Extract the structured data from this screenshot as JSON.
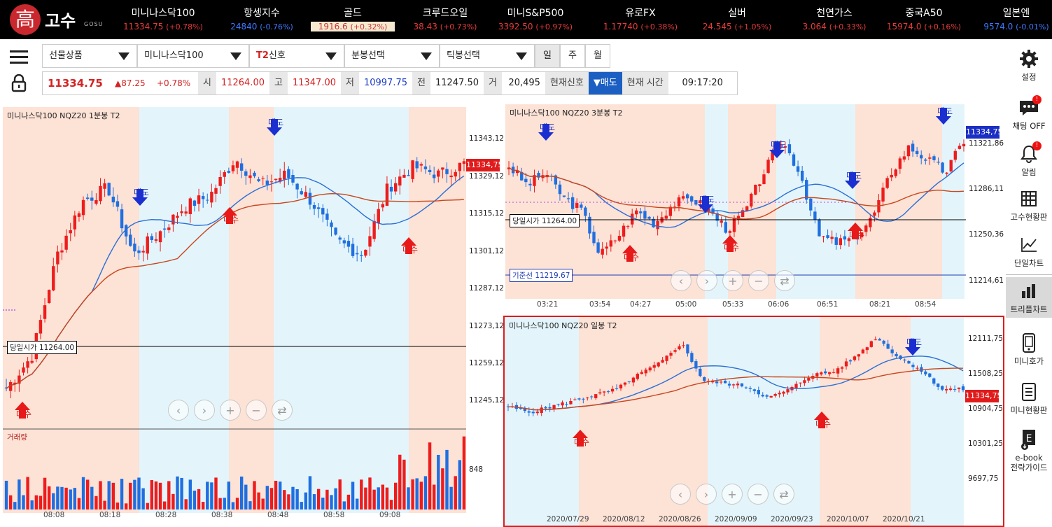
{
  "logo": {
    "mark": "高",
    "name": "고수",
    "sub": "GOSU"
  },
  "tickers": [
    {
      "name": "미니나스닥100",
      "price": "11334.75",
      "change": "(+0.78%)",
      "dir": "up"
    },
    {
      "name": "항셍지수",
      "price": "24840",
      "change": "(-0.76%)",
      "dir": "dn"
    },
    {
      "name": "골드",
      "price": "1916.6",
      "change": "(+0.32%)",
      "dir": "up",
      "hl": true
    },
    {
      "name": "크루드오일",
      "price": "38.43",
      "change": "(+0.73%)",
      "dir": "up"
    },
    {
      "name": "미니S&P500",
      "price": "3392.50",
      "change": "(+0.97%)",
      "dir": "up"
    },
    {
      "name": "유로FX",
      "price": "1.17740",
      "change": "(+0.38%)",
      "dir": "up"
    },
    {
      "name": "실버",
      "price": "24.545",
      "change": "(+1.05%)",
      "dir": "up"
    },
    {
      "name": "천연가스",
      "price": "3.064",
      "change": "(+0.33%)",
      "dir": "up"
    },
    {
      "name": "중국A50",
      "price": "15974.0",
      "change": "(+0.16%)",
      "dir": "up"
    },
    {
      "name": "일본엔",
      "price": "9574.0",
      "change": "(-0.01%)",
      "dir": "dn"
    }
  ],
  "toolbar": {
    "select1": "선물상품",
    "select2": "미니나스닥100",
    "select3_prefix": "T2",
    "select3": "신호",
    "select4": "분봉선택",
    "select5": "틱봉선택",
    "period_day": "일",
    "period_week": "주",
    "period_month": "월"
  },
  "quote": {
    "price": "11334.75",
    "change": "▲87.25",
    "pct": "+0.78%",
    "open_label": "시",
    "open": "11264.00",
    "high_label": "고",
    "high": "11347.00",
    "low_label": "저",
    "low": "10997.75",
    "prev_label": "전",
    "prev": "11247.50",
    "vol_label": "거",
    "vol": "20,495",
    "signal_label": "현재신호",
    "signal": "▼매도",
    "time_label": "현재 시간",
    "time": "09:17:20"
  },
  "sidebar": [
    {
      "label": "설정",
      "icon": "gear-icon"
    },
    {
      "label": "채팅 OFF",
      "icon": "chat-icon",
      "badge": "!"
    },
    {
      "label": "알림",
      "icon": "bell-icon",
      "badge": "!"
    },
    {
      "label": "고수현황판",
      "icon": "grid-icon"
    },
    {
      "label": "단일차트",
      "icon": "line-chart-icon"
    },
    {
      "label": "트리플차트",
      "icon": "bar-chart-icon",
      "active": true
    },
    {
      "label": "미니호가",
      "icon": "phone-icon"
    },
    {
      "label": "미니현황판",
      "icon": "list-icon"
    },
    {
      "label": "e-book\n전략가이드",
      "icon": "ebook-icon"
    }
  ],
  "chart_data": [
    {
      "type": "candlestick",
      "title": "미니나스닥100  NQZ20  1분봉  T2",
      "x_ticks": [
        "08:08",
        "08:18",
        "08:28",
        "08:38",
        "08:48",
        "08:58",
        "09:08"
      ],
      "y_ticks": [
        "11343,12",
        "11329,12",
        "11315,12",
        "11301,12",
        "11287,12",
        "11273,12",
        "11259,12",
        "11245,12"
      ],
      "ylim": [
        11240,
        11350
      ],
      "current": "11334,75",
      "open_label": "당일시가 11264.00",
      "volume_label": "거래량",
      "volume_tick": "848",
      "signals": [
        {
          "type": "매수",
          "x": "08:08"
        },
        {
          "type": "매도",
          "x": "08:18"
        },
        {
          "type": "매수",
          "x": "08:38"
        },
        {
          "type": "매도",
          "x": "08:48"
        },
        {
          "type": "매수",
          "x": "09:08"
        }
      ]
    },
    {
      "type": "candlestick",
      "title": "미니나스닥100  NQZ20  3분봉  T2",
      "x_ticks": [
        "03:21",
        "03:54",
        "04:27",
        "05:00",
        "05:33",
        "06:06",
        "06:51",
        "08:21",
        "08:54"
      ],
      "y_ticks": [
        "11321,86",
        "11286,11",
        "11250,36",
        "11214,61"
      ],
      "ylim": [
        11205,
        11350
      ],
      "current": "11334,75",
      "open_label": "당일시가 11264.00",
      "base_label": "기준선 11219.67",
      "signals": [
        {
          "type": "매도",
          "x": "03:21"
        },
        {
          "type": "매수",
          "x": "04:27"
        },
        {
          "type": "매도",
          "x": "05:00"
        },
        {
          "type": "매수",
          "x": "05:33"
        },
        {
          "type": "매도",
          "x": "06:06"
        },
        {
          "type": "매도",
          "x": "08:21"
        },
        {
          "type": "매수",
          "x": "08:21"
        },
        {
          "type": "매도",
          "x": "08:54"
        }
      ]
    },
    {
      "type": "candlestick",
      "title": "미니나스닥100  NQZ20  일봉  T2",
      "x_ticks": [
        "2020/07/29",
        "2020/08/12",
        "2020/08/26",
        "2020/09/09",
        "2020/09/23",
        "2020/10/07",
        "2020/10/21"
      ],
      "y_ticks": [
        "12111,75",
        "11508,25",
        "10904,75",
        "10301,25",
        "9697,75"
      ],
      "ylim": [
        9500,
        12400
      ],
      "current": "11334,75",
      "signals": [
        {
          "type": "매수",
          "x": "2020/07/29"
        },
        {
          "type": "매수",
          "x": "2020/09/23"
        },
        {
          "type": "매도",
          "x": "2020/10/21"
        }
      ]
    }
  ],
  "colors": {
    "up": "#ee1c1c",
    "down": "#1f6fe0",
    "sell_zone": "#fde2d6",
    "buy_zone": "#e3f5fb",
    "ma_blue": "#2a6fd6",
    "ma_orange": "#c9461c"
  }
}
